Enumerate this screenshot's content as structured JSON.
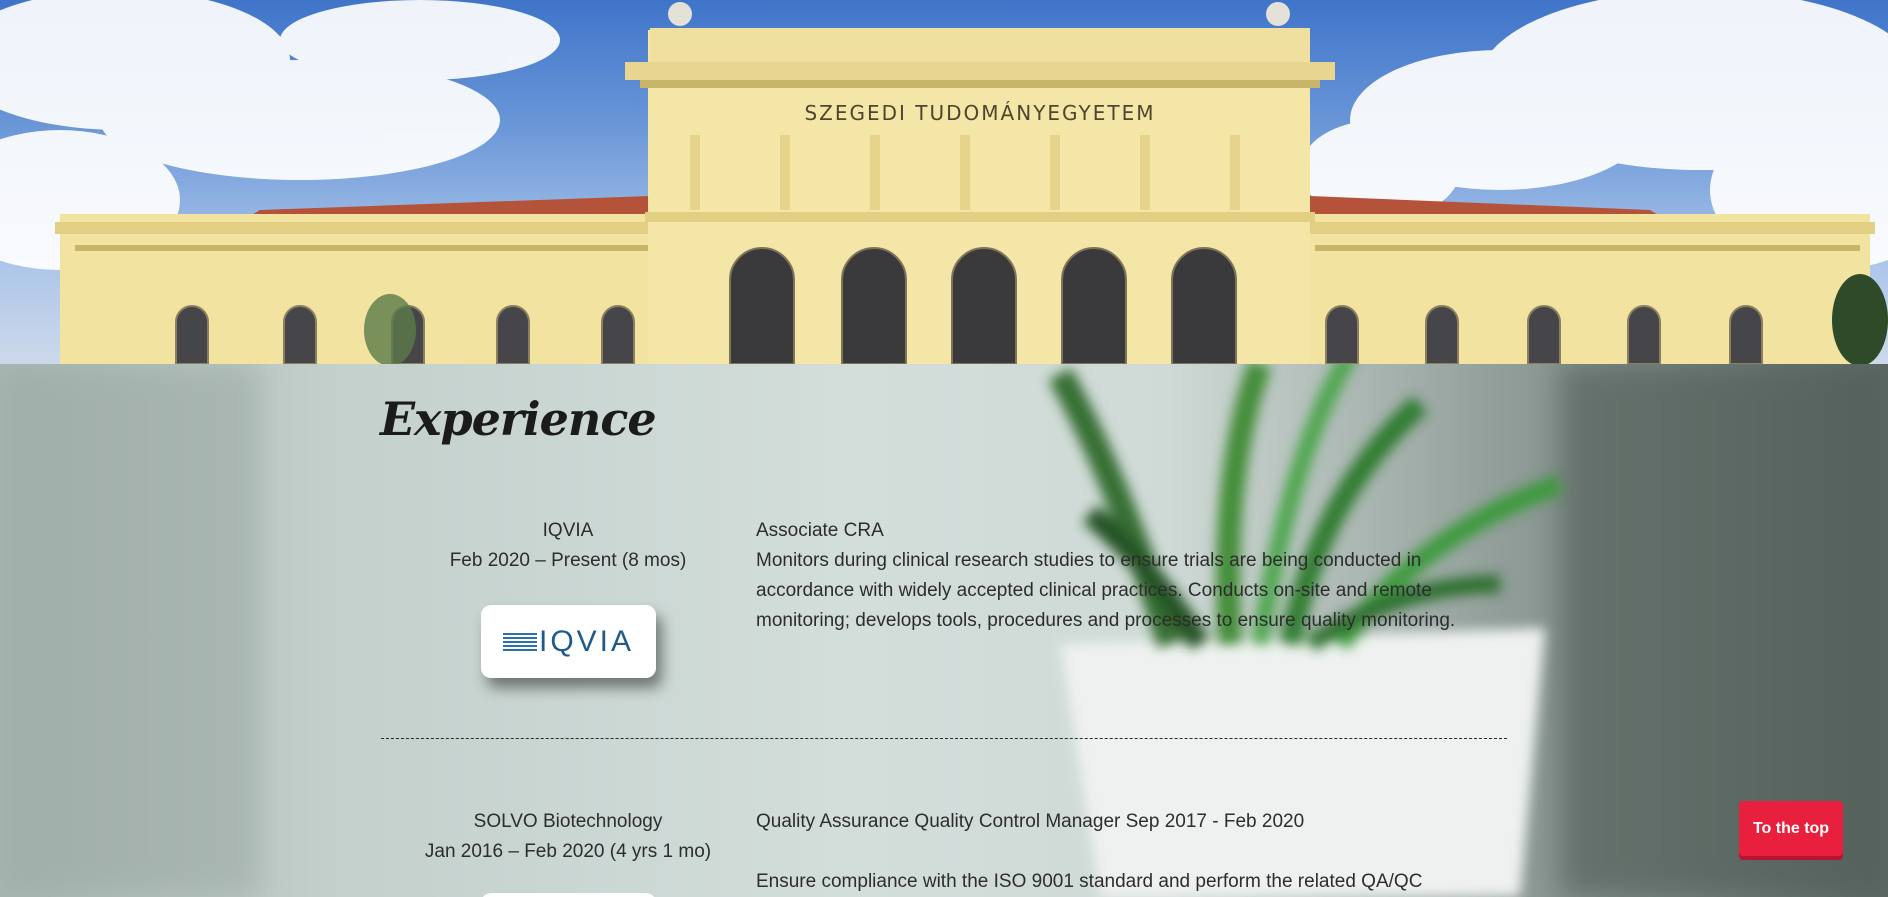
{
  "hero": {
    "building_inscription": "SZEGEDI TUDOMÁNYEGYETEM"
  },
  "experience": {
    "title": "Experience",
    "jobs": [
      {
        "company": "IQVIA",
        "period": "Feb 2020 – Present (8 mos)",
        "logo_text": "IQVIA",
        "role": "Associate CRA",
        "description": "Monitors during clinical research studies to ensure trials are being conducted in accordance with widely accepted clinical practices. Conducts on-site and remote monitoring; develops tools, procedures and processes to ensure quality monitoring."
      },
      {
        "company": "SOLVO Biotechnology",
        "period": "Jan 2016 – Feb 2020 (4 yrs 1 mo)",
        "role": "Quality Assurance Quality Control Manager Sep 2017 - Feb 2020",
        "description": "Ensure compliance with the ISO 9001 standard and perform the related QA/QC"
      }
    ]
  },
  "to_top_label": "To the top",
  "colors": {
    "accent": "#e8203d",
    "text": "#2d2d2d",
    "building": "#f2e3a0"
  }
}
